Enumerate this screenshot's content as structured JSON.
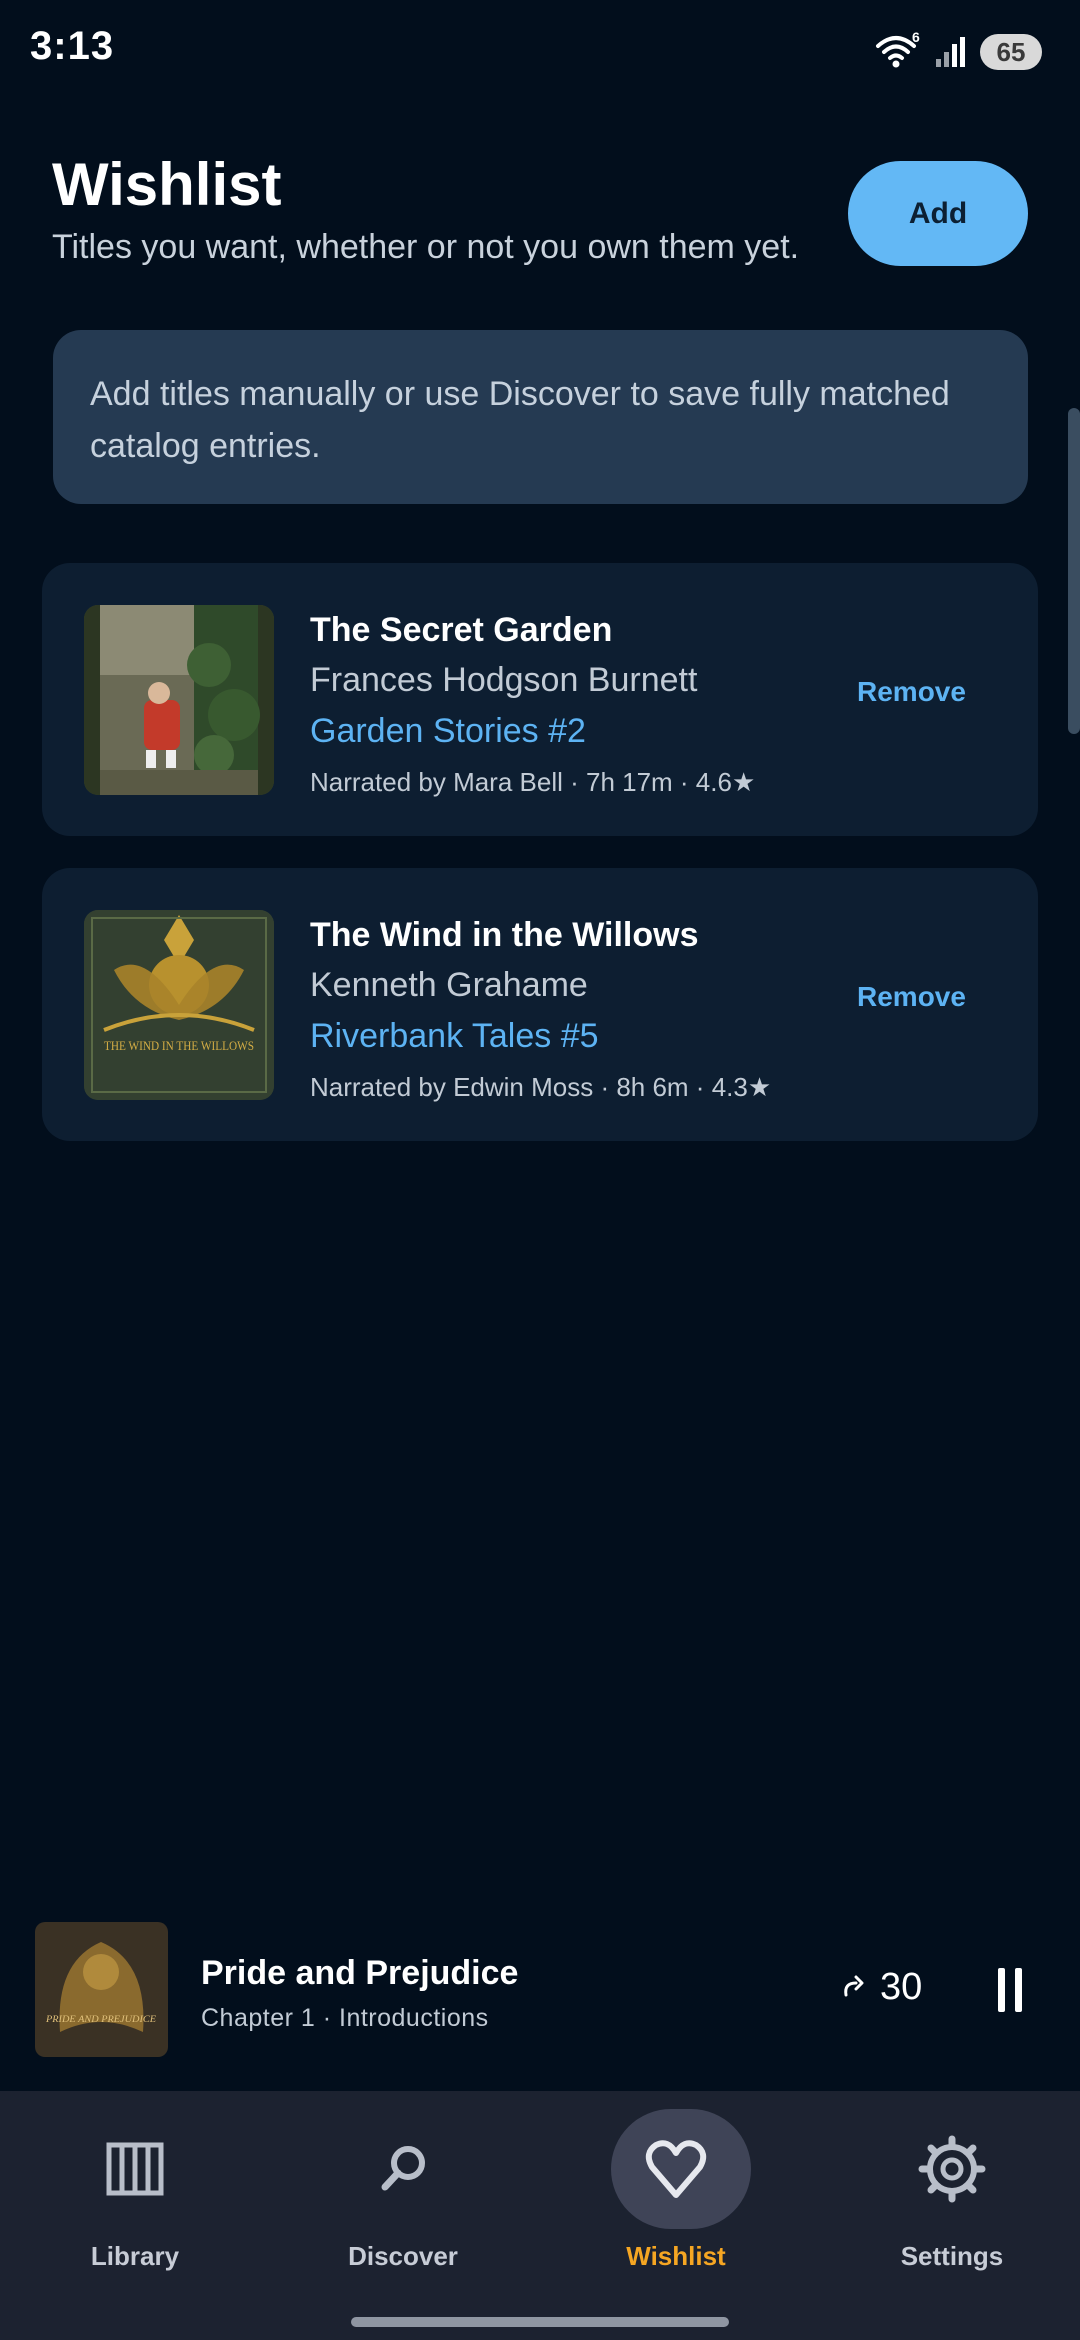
{
  "status_bar": {
    "time": "3:13",
    "battery": "65",
    "wifi_badge": "6"
  },
  "header": {
    "title": "Wishlist",
    "subtitle": "Titles you want, whether or not you own them yet.",
    "add_label": "Add"
  },
  "banner": {
    "text": "Add titles manually or use Discover to save fully matched catalog entries."
  },
  "books": [
    {
      "title": "The Secret Garden",
      "author": "Frances Hodgson Burnett",
      "series": "Garden Stories #2",
      "meta": "Narrated by Mara Bell · 7h 17m · 4.6★",
      "remove_label": "Remove"
    },
    {
      "title": "The Wind in the Willows",
      "author": "Kenneth Grahame",
      "series": "Riverbank Tales #5",
      "meta": "Narrated by Edwin Moss · 8h 6m · 4.3★",
      "remove_label": "Remove",
      "cover_text": "THE WIND IN THE WILLOWS"
    }
  ],
  "now_playing": {
    "title": "Pride and Prejudice",
    "chapter": "Chapter 1 · Introductions",
    "skip_seconds": "30",
    "cover_text": "PRIDE AND PREJUDICE"
  },
  "nav": {
    "items": [
      {
        "label": "Library",
        "icon": "library-icon"
      },
      {
        "label": "Discover",
        "icon": "search-icon"
      },
      {
        "label": "Wishlist",
        "icon": "heart-icon",
        "active": true
      },
      {
        "label": "Settings",
        "icon": "gear-icon"
      }
    ]
  },
  "colors": {
    "accent": "#63b8f5",
    "link": "#5db3f3",
    "active_nav": "#f5a623",
    "background": "#020e1c"
  }
}
